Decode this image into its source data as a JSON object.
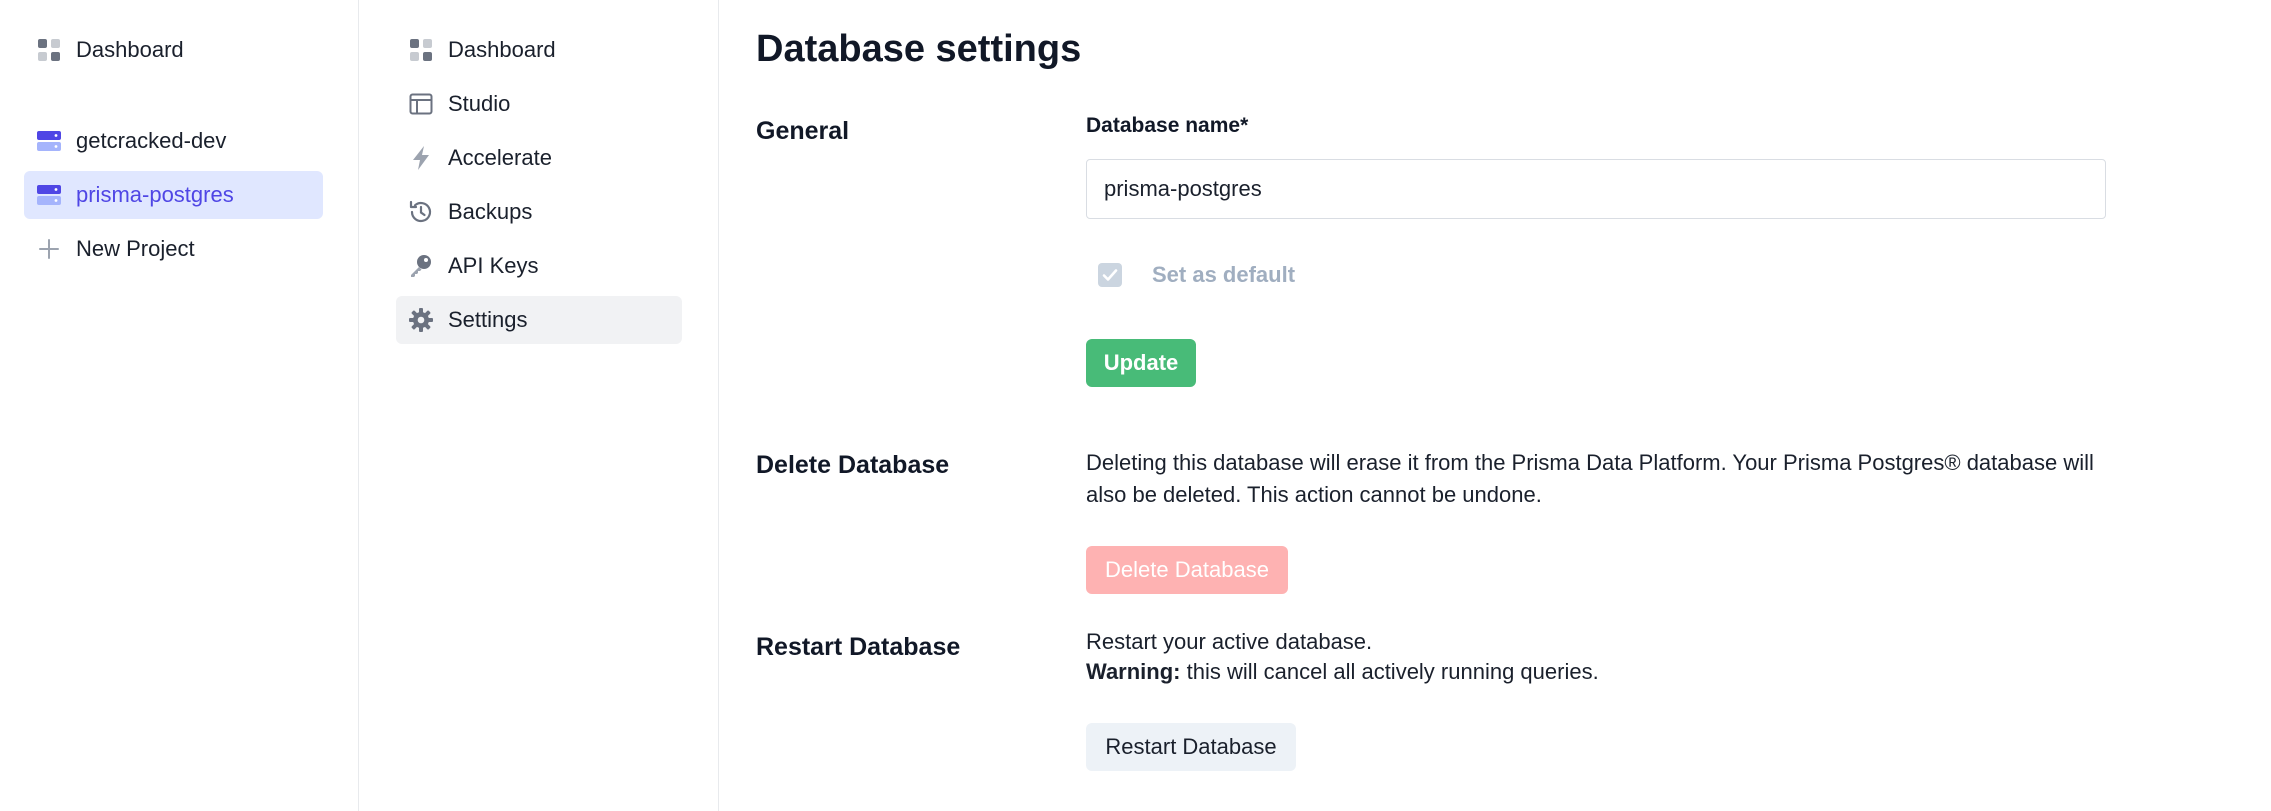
{
  "project_sidebar": {
    "dashboard_label": "Dashboard",
    "projects": [
      {
        "label": "getcracked-dev",
        "active": false
      },
      {
        "label": "prisma-postgres",
        "active": true
      }
    ],
    "new_project_label": "New Project"
  },
  "nav": {
    "items": [
      {
        "label": "Dashboard",
        "icon": "dashboard-icon"
      },
      {
        "label": "Studio",
        "icon": "studio-icon"
      },
      {
        "label": "Accelerate",
        "icon": "bolt-icon"
      },
      {
        "label": "Backups",
        "icon": "history-icon"
      },
      {
        "label": "API Keys",
        "icon": "key-icon"
      },
      {
        "label": "Settings",
        "icon": "gear-icon",
        "active": true
      }
    ]
  },
  "main": {
    "title": "Database settings",
    "general": {
      "section_label": "General",
      "name_label": "Database name",
      "required_mark": "*",
      "name_value": "prisma-postgres",
      "default_label": "Set as default",
      "default_checked": true,
      "update_label": "Update"
    },
    "delete": {
      "section_label": "Delete Database",
      "description": "Deleting this database will erase it from the Prisma Data Platform. Your Prisma Postgres® database will also be deleted. This action cannot be undone.",
      "button_label": "Delete Database"
    },
    "restart": {
      "section_label": "Restart Database",
      "description": "Restart your active database.",
      "warning_label": "Warning:",
      "warning_text": " this will cancel all actively running queries.",
      "button_label": "Restart Database"
    }
  },
  "colors": {
    "accent": "#4f46e5",
    "active_project_bg": "#e0e7ff",
    "update_green": "#48bb78",
    "delete_red_disabled": "#feb2b2",
    "required_red": "#e53e3e"
  }
}
